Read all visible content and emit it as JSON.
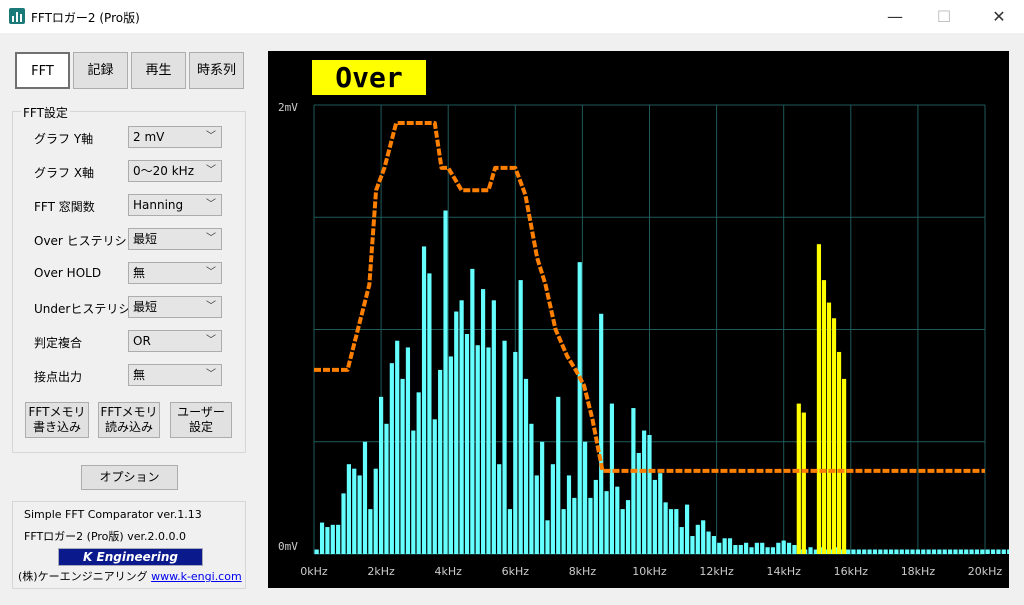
{
  "window": {
    "title": "FFTロガー2 (Pro版)",
    "minimize_glyph": "—",
    "maximize_glyph": "☐",
    "close_glyph": "✕"
  },
  "tabs": [
    {
      "label": "FFT",
      "active": true
    },
    {
      "label": "記録"
    },
    {
      "label": "再生"
    },
    {
      "label": "時系列"
    }
  ],
  "settings": {
    "group_title": "FFT設定",
    "rows": [
      {
        "label": "グラフ Y軸",
        "value": "2 mV"
      },
      {
        "label": "グラフ X軸",
        "value": "0～20 kHz"
      },
      {
        "label": "FFT 窓関数",
        "value": "Hanning"
      },
      {
        "label": "Over ヒステリシス",
        "value": "最短"
      },
      {
        "label": "Over HOLD",
        "value": "無"
      },
      {
        "label": "Underヒステリシス",
        "value": "最短"
      },
      {
        "label": "判定複合",
        "value": "OR"
      },
      {
        "label": "接点出力",
        "value": "無"
      }
    ],
    "buttons": [
      {
        "line1": "FFTメモリ",
        "line2": "書き込み"
      },
      {
        "line1": "FFTメモリ",
        "line2": "読み込み"
      },
      {
        "line1": "ユーザー",
        "line2": "設定"
      }
    ]
  },
  "options_button": "オプション",
  "info": {
    "line1": "Simple FFT Comparator  ver.1.13",
    "line2": "FFTロガー2 (Pro版)  ver.2.0.0.0",
    "logo": "K Engineering",
    "company": "(株)ケーエンジニアリング",
    "url": "www.k-engi.com"
  },
  "status_badge": "Over",
  "colors": {
    "accent_status": "#ffff00",
    "spectrum": "#66ffff",
    "over_spectrum": "#ffff00",
    "threshold": "#ff7f00",
    "grid": "#1f5a5a",
    "background": "#000000"
  },
  "chart_data": {
    "type": "bar",
    "xlabel": "",
    "ylabel": "",
    "xlim": [
      0,
      20
    ],
    "ylim": [
      0,
      2
    ],
    "x_unit": "kHz",
    "y_top_label": "2mV",
    "y_bottom_label": "0mV",
    "x_ticks": [
      "0kHz",
      "2kHz",
      "4kHz",
      "6kHz",
      "8kHz",
      "10kHz",
      "12kHz",
      "14kHz",
      "16kHz",
      "18kHz",
      "20kHz"
    ],
    "grid": true,
    "bar_width_khz": 0.16,
    "series": [
      {
        "values": [
          0.02,
          0.14,
          0.12,
          0.13,
          0.13,
          0.27,
          0.4,
          0.38,
          0.35,
          0.5,
          0.2,
          0.38,
          0.7,
          0.58,
          0.85,
          0.95,
          0.78,
          0.92,
          0.55,
          0.72,
          1.37,
          1.25,
          0.6,
          0.82,
          1.53,
          0.88,
          1.08,
          1.13,
          0.98,
          1.27,
          0.93,
          1.18,
          0.92,
          1.13,
          0.4,
          0.95,
          0.2,
          0.9,
          1.22,
          0.78,
          0.58,
          0.35,
          0.5,
          0.15,
          0.4,
          0.7,
          0.2,
          0.35,
          0.25,
          1.3,
          0.5,
          0.25,
          0.33,
          1.07,
          0.28,
          0.67,
          0.3,
          0.2,
          0.24,
          0.65,
          0.45,
          0.55,
          0.53,
          0.33,
          0.36,
          0.23,
          0.2,
          0.2,
          0.12,
          0.22,
          0.08,
          0.13,
          0.15,
          0.1,
          0.08,
          0.05,
          0.07,
          0.07,
          0.04,
          0.04,
          0.05,
          0.03,
          0.05,
          0.05,
          0.03,
          0.03,
          0.05,
          0.06,
          0.05,
          0.04,
          0.02,
          0.02,
          0.03,
          0.02,
          0.03,
          0.02,
          0.02,
          0.03,
          0.02,
          0.02,
          0.02,
          0.02,
          0.02,
          0.02,
          0.02,
          0.02,
          0.02,
          0.02,
          0.02,
          0.02,
          0.02,
          0.02,
          0.02,
          0.02,
          0.02,
          0.02,
          0.02,
          0.02,
          0.02,
          0.02,
          0.02,
          0.02,
          0.02,
          0.02,
          0.02,
          0.02,
          0.02,
          0.02,
          0.02,
          0.02,
          0.02,
          0.02,
          0.02,
          0.35,
          0.23,
          0.05,
          0.05,
          0.05,
          0.02,
          0.02,
          0.02,
          0.02,
          0.02,
          0.02,
          0.02,
          0.02,
          0.02,
          0.02,
          0.02,
          0.02,
          0.02,
          0.02,
          0.02,
          0.02,
          0.02,
          0.02,
          0.02,
          0.02,
          0.02,
          0.02,
          0.02
        ]
      },
      {
        "x": [
          14.45,
          14.6,
          15.05,
          15.2,
          15.35,
          15.5,
          15.65,
          15.8
        ],
        "values": [
          0.67,
          0.63,
          1.38,
          1.22,
          1.12,
          1.05,
          0.9,
          0.78
        ]
      }
    ],
    "threshold": {
      "x": [
        0,
        0.7,
        1.0,
        1.65,
        1.85,
        2.1,
        2.45,
        2.7,
        3.6,
        3.8,
        4.0,
        4.4,
        5.2,
        5.4,
        6.0,
        6.3,
        6.65,
        6.9,
        7.2,
        7.55,
        7.8,
        8.05,
        8.3,
        8.6,
        20
      ],
      "y": [
        0.82,
        0.82,
        0.82,
        1.2,
        1.62,
        1.72,
        1.92,
        1.92,
        1.92,
        1.72,
        1.72,
        1.62,
        1.62,
        1.72,
        1.72,
        1.6,
        1.32,
        1.2,
        1.0,
        0.88,
        0.82,
        0.75,
        0.6,
        0.37,
        0.37
      ]
    }
  }
}
